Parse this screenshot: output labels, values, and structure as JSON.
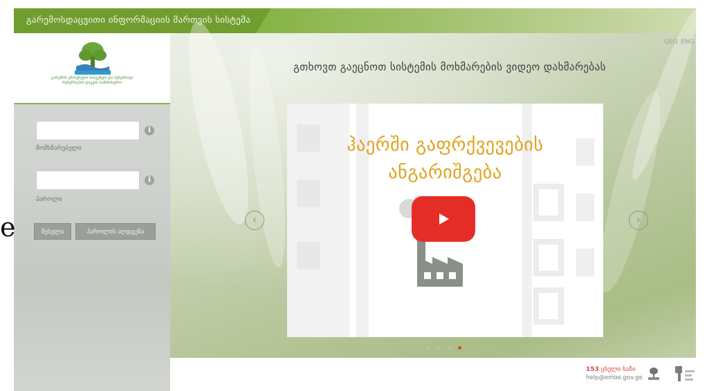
{
  "header": {
    "title": "გარემოსდაცვითი ინფორმაციის მართვის სისტემა"
  },
  "sidebar": {
    "logo_caption": "გარემოს ეროვნული სააგენტო და ბუნებრივი რესურსების დაცვის სამინისტრო",
    "username_label": "მომხმარებელი",
    "username_value": "",
    "password_label": "პაროლი",
    "password_value": "",
    "login_button": "შესვლა",
    "register_button": "პაროლის აღდგენა"
  },
  "language": {
    "geo": "GEO",
    "eng": "ENG"
  },
  "main": {
    "heading": "გთხოვთ გაეცნოთ სისტემის მოხმარების ვიდეო დახმარებას",
    "slide_title_line1": "ჰაერში გაფრქვევების",
    "slide_title_line2": "ანგარიშგება",
    "prev_arrow": "‹",
    "next_arrow": "›",
    "carousel": {
      "count": 4,
      "active": 4
    }
  },
  "footer": {
    "phone_number": "153",
    "phone_note": "ცხელი ხაზი",
    "email": "help@emoe.gov.ge"
  },
  "edge_glyph": "e",
  "colors": {
    "brand_green": "#6f9e2f",
    "accent_orange": "#e0a11a",
    "youtube_red": "#e52d27",
    "active_dot": "#d24a3a"
  }
}
